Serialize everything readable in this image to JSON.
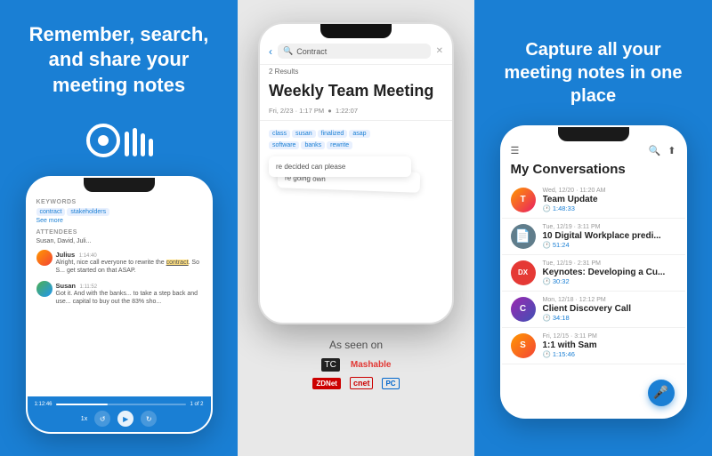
{
  "left_panel": {
    "tagline": "Remember, search, and share your meeting notes",
    "logo": {
      "circle_bars": [
        "20px",
        "28px",
        "22px",
        "16px"
      ]
    },
    "phone": {
      "keywords_label": "KEYWORDS",
      "keywords": [
        "contract",
        "stakeholders"
      ],
      "see_more": "See more",
      "attendees_label": "ATTENDEES",
      "attendees": "Susan, David, Juli...",
      "julius_name": "Julius",
      "julius_time": "1:14:40",
      "julius_text": "Alright, nice call everyone to rewrite the contract. So S... get started on that ASAP.",
      "susan_name": "Susan",
      "susan_time": "1:11:52",
      "susan_text": "Got it. And with the banks... to take a step back and use... capital to buy out the 83% sho...",
      "progress_start": "1:12:46",
      "page_indicator": "1 of 2",
      "speed": "1x"
    }
  },
  "center_panel": {
    "phone": {
      "search_text": "Contract",
      "results_count": "2 Results",
      "meeting_title": "Weekly Team Meeting",
      "meeting_date": "Fri, 2/23 · 1:17 PM",
      "meeting_duration": "1:22:07",
      "transcript_keywords": [
        "class",
        "susan",
        "finalized",
        "asap",
        "software",
        "banks",
        "rewrite"
      ],
      "transcript_1": "re decided\ncan please",
      "transcript_2": "re going\nown"
    },
    "as_seen_on": {
      "label": "As seen on",
      "logos_row1": [
        "TC",
        "Mashable"
      ],
      "logos_row2": [
        "ZDNet",
        "cnet",
        "PC"
      ]
    }
  },
  "right_panel": {
    "tagline": "Capture all your meeting notes in one place",
    "conversations_title": "My Conversations",
    "conversations": [
      {
        "date": "Wed, 12/20 · 11:20 AM",
        "name": "Team Update",
        "duration": "1:48:33",
        "avatar_label": "T",
        "avatar_class": "conv-avatar-1"
      },
      {
        "date": "Tue, 12/19 · 3:11 PM",
        "name": "10 Digital Workplace predi...",
        "duration": "51:24",
        "avatar_label": "📄",
        "avatar_class": "conv-avatar-2"
      },
      {
        "date": "Tue, 12/19 · 2:31 PM",
        "name": "Keynotes: Developing a Cu...",
        "duration": "30:32",
        "avatar_label": "DX",
        "avatar_class": "conv-avatar-3"
      },
      {
        "date": "Mon, 12/18 · 12:12 PM",
        "name": "Client Discovery Call",
        "duration": "34:18",
        "avatar_label": "C",
        "avatar_class": "conv-avatar-4"
      },
      {
        "date": "Fri, 12/15 · 3:11 PM",
        "name": "1:1 with Sam",
        "duration": "1:15:46",
        "avatar_label": "S",
        "avatar_class": "conv-avatar-5"
      }
    ],
    "mic_icon": "🎤"
  }
}
